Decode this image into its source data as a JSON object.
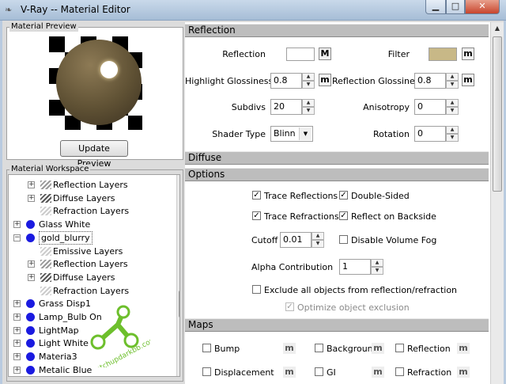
{
  "window": {
    "title": "V-Ray -- Material Editor",
    "min_glyph": "▁",
    "max_glyph": "□",
    "close_glyph": "✕",
    "app_icon": "vray-icon"
  },
  "preview": {
    "group_label": "Material Preview",
    "update_button": "Update Preview"
  },
  "workspace": {
    "group_label": "Material Workspace",
    "items": [
      {
        "label": "Reflection Layers",
        "kind": "layer",
        "level": 2,
        "expander": "+"
      },
      {
        "label": "Diffuse Layers",
        "kind": "layer-dark",
        "level": 2,
        "expander": "+"
      },
      {
        "label": "Refraction Layers",
        "kind": "layer-light",
        "level": 2,
        "expander": ""
      },
      {
        "label": "Glass White",
        "kind": "material",
        "level": 1,
        "expander": "+"
      },
      {
        "label": "gold_blurry",
        "kind": "material",
        "level": 1,
        "expander": "−",
        "selected": true
      },
      {
        "label": "Emissive Layers",
        "kind": "layer-light",
        "level": 2,
        "expander": ""
      },
      {
        "label": "Reflection Layers",
        "kind": "layer",
        "level": 2,
        "expander": "+"
      },
      {
        "label": "Diffuse Layers",
        "kind": "layer-dark",
        "level": 2,
        "expander": "+"
      },
      {
        "label": "Refraction Layers",
        "kind": "layer-light",
        "level": 2,
        "expander": ""
      },
      {
        "label": "Grass Disp1",
        "kind": "material",
        "level": 1,
        "expander": "+"
      },
      {
        "label": "Lamp_Bulb On",
        "kind": "material",
        "level": 1,
        "expander": "+"
      },
      {
        "label": "LightMap",
        "kind": "material",
        "level": 1,
        "expander": "+"
      },
      {
        "label": "Light White",
        "kind": "material",
        "level": 1,
        "expander": "+"
      },
      {
        "label": "Materia3",
        "kind": "material",
        "level": 1,
        "expander": "+"
      },
      {
        "label": "Metalic Blue",
        "kind": "material",
        "level": 1,
        "expander": "+"
      }
    ]
  },
  "reflection": {
    "header": "Reflection",
    "reflection_label": "Reflection",
    "filter_label": "Filter",
    "reflection_color": "#ffffff",
    "filter_color": "#c8b887",
    "map_btn": "M",
    "map_btn_small": "m",
    "highlight_glossiness_label": "Highlight Glossiness",
    "highlight_glossiness": "0.8",
    "reflection_glossiness_label": "Reflection Glossiness",
    "reflection_glossiness": "0.8",
    "subdivs_label": "Subdivs",
    "subdivs": "20",
    "anisotropy_label": "Anisotropy",
    "anisotropy": "0",
    "shader_type_label": "Shader Type",
    "shader_type": "Blinn",
    "rotation_label": "Rotation",
    "rotation": "0"
  },
  "diffuse": {
    "header": "Diffuse"
  },
  "options": {
    "header": "Options",
    "trace_reflections": "Trace Reflections",
    "double_sided": "Double-Sided",
    "trace_refractions": "Trace Refractions",
    "reflect_on_backside": "Reflect on Backside",
    "cutoff_label": "Cutoff",
    "cutoff": "0.01",
    "disable_volume_fog": "Disable Volume Fog",
    "alpha_contribution_label": "Alpha Contribution",
    "alpha_contribution": "1",
    "exclude_all": "Exclude all objects from reflection/refraction",
    "optimize_exclusion": "Optimize object exclusion",
    "check_glyph": "✓"
  },
  "maps": {
    "header": "Maps",
    "map_btn": "m",
    "items": [
      "Bump",
      "Background",
      "Reflection",
      "Displacement",
      "GI",
      "Refraction"
    ]
  },
  "watermark": {
    "text": "sketchupdarkbb.com",
    "color": "#6dbf2c"
  }
}
